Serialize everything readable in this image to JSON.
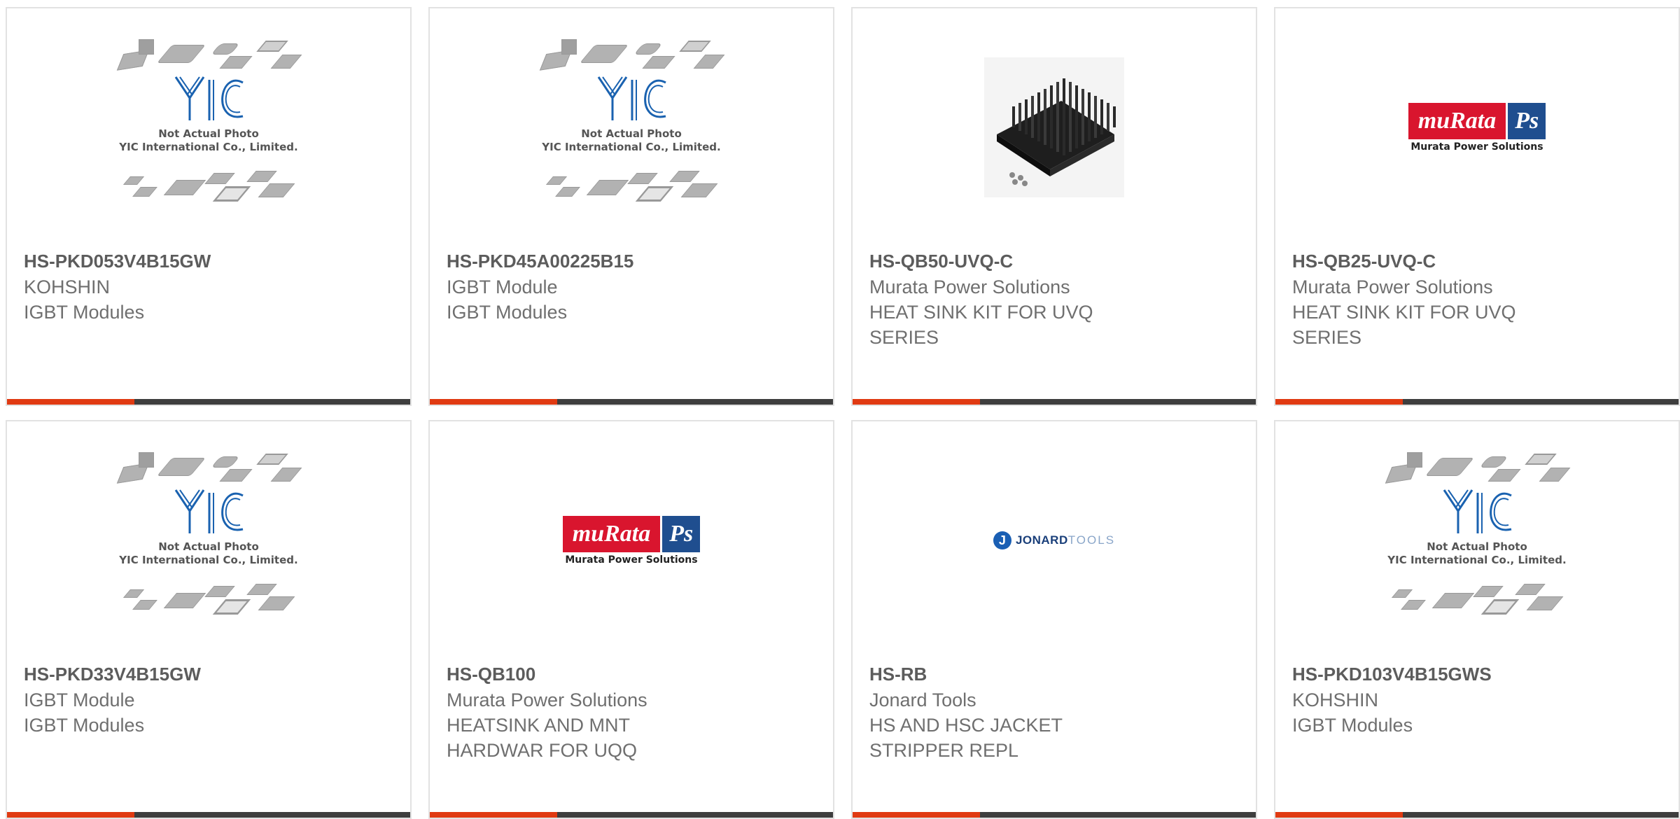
{
  "products": [
    {
      "part": "HS-PKD053V4B15GW",
      "line1": "KOHSHIN",
      "line2": "IGBT Modules",
      "line3": "",
      "image": "yic-placeholder"
    },
    {
      "part": "HS-PKD45A00225B15",
      "line1": "IGBT Module",
      "line2": "IGBT Modules",
      "line3": "",
      "image": "yic-placeholder"
    },
    {
      "part": "HS-QB50-UVQ-C",
      "line1": "Murata Power Solutions",
      "line2": "HEAT SINK KIT FOR UVQ",
      "line3": "SERIES",
      "image": "heatsink-photo"
    },
    {
      "part": "HS-QB25-UVQ-C",
      "line1": "Murata Power Solutions",
      "line2": "HEAT SINK KIT FOR UVQ",
      "line3": "SERIES",
      "image": "murata-logo"
    },
    {
      "part": "HS-PKD33V4B15GW",
      "line1": "IGBT Module",
      "line2": "IGBT Modules",
      "line3": "",
      "image": "yic-placeholder"
    },
    {
      "part": "HS-QB100",
      "line1": "Murata Power Solutions",
      "line2": "HEATSINK AND MNT",
      "line3": "HARDWAR FOR UQQ",
      "image": "murata-logo"
    },
    {
      "part": "HS-RB",
      "line1": "Jonard Tools",
      "line2": "HS AND HSC JACKET",
      "line3": "STRIPPER REPL",
      "image": "jonard-logo"
    },
    {
      "part": "HS-PKD103V4B15GWS",
      "line1": "KOHSHIN",
      "line2": "IGBT Modules",
      "line3": "",
      "image": "yic-placeholder"
    }
  ],
  "yic": {
    "brand": "YIC",
    "note1": "Not Actual Photo",
    "note2": "YIC International Co., Limited."
  },
  "murata": {
    "brand": "muRata",
    "ps": "Ps",
    "tagline": "Murata Power Solutions"
  },
  "jonard": {
    "bold": "JONARD",
    "light": "TOOLS",
    "mark": "J"
  },
  "colors": {
    "accent": "#e03a12",
    "bar": "#3e3e3e",
    "border": "#e2e2e2",
    "part_text": "#5c5c5c",
    "text": "#6f6f6f",
    "yic_blue": "#1a62b0",
    "murata_red": "#d9152e",
    "murata_blue": "#1f4e8f"
  }
}
